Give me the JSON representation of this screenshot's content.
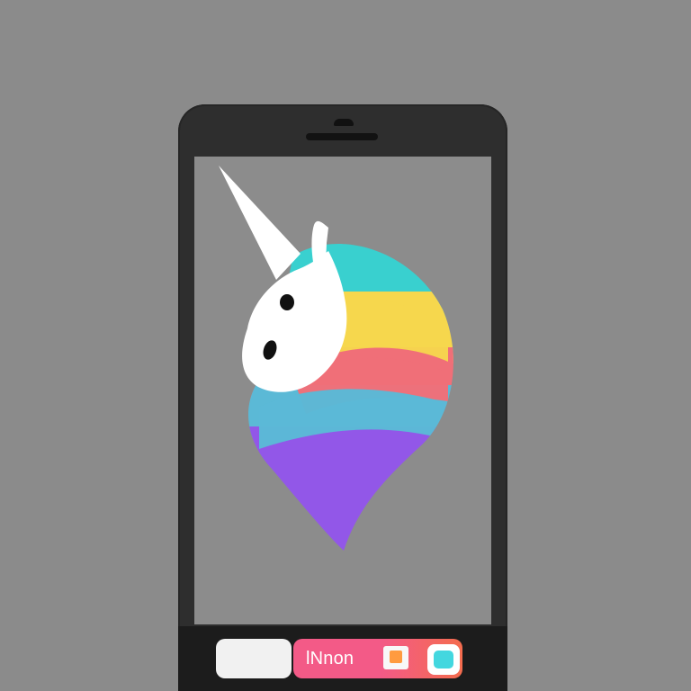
{
  "device": {
    "type": "smartphone"
  },
  "screen": {
    "artwork": {
      "subject": "unicorn",
      "colors": [
        "#ffffff",
        "#39d0cf",
        "#f6d74d",
        "#f06f78",
        "#5bb9d6",
        "#9257e8"
      ]
    }
  },
  "dock": {
    "brand_label": "lNnon",
    "accent_pink": "#f35a87",
    "accent_orange": "#f46c4e",
    "accent_cyan": "#43d7df"
  }
}
